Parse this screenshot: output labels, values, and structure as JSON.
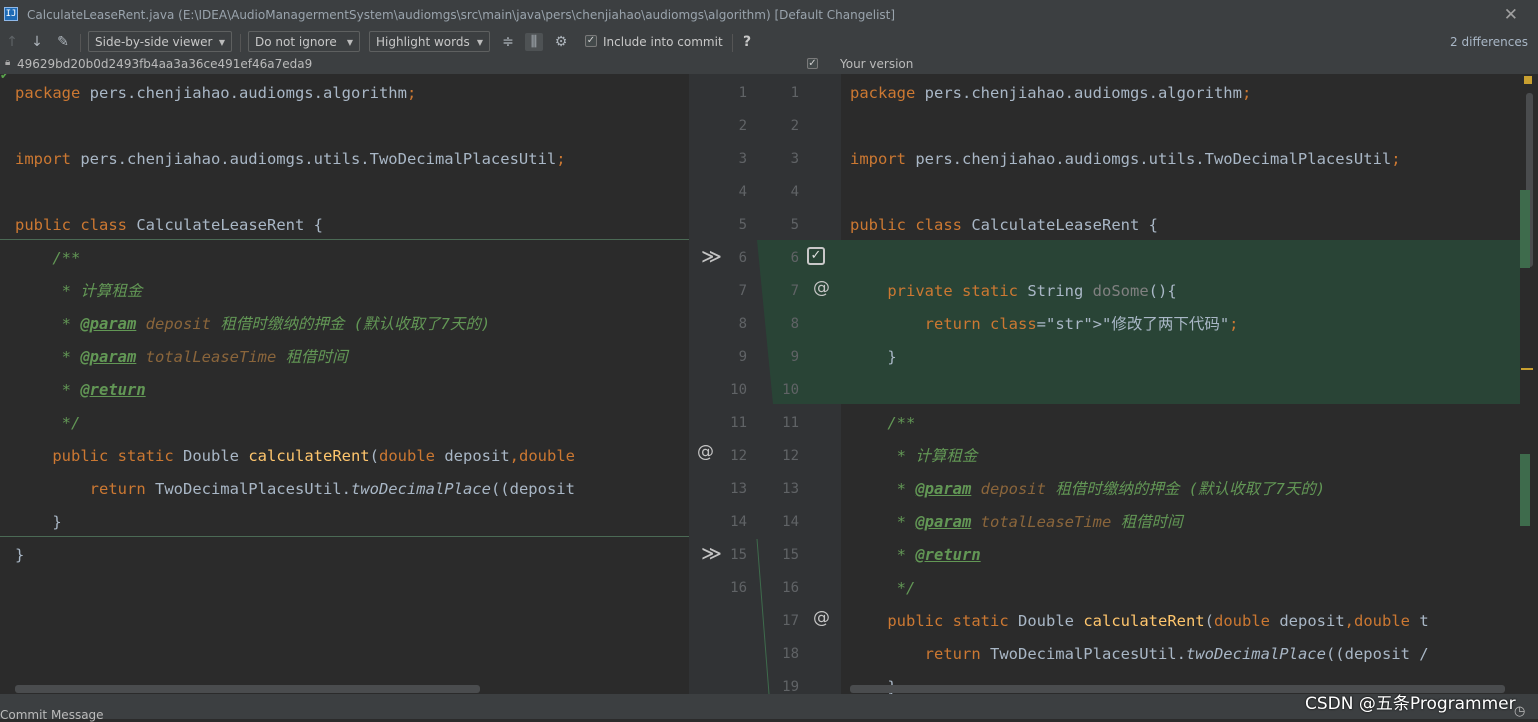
{
  "window": {
    "title": "CalculateLeaseRent.java (E:\\IDEA\\AudioManagermentSystem\\audiomgs\\src\\main\\java\\pers\\chenjiahao\\audiomgs\\algorithm) [Default Changelist]",
    "app_icon": "IJ"
  },
  "toolbar": {
    "viewer_mode": "Side-by-side viewer",
    "ignore_mode": "Do not ignore",
    "highlight_mode": "Highlight words",
    "include_commit": "Include into commit",
    "help": "?",
    "differences": "2 differences"
  },
  "headers": {
    "left_revision": "49629bd20b0d2493fb4aa3a36ce491ef46a7eda9",
    "right_title": "Your version"
  },
  "left_gutter_numbers": [
    "1",
    "2",
    "3",
    "4",
    "5",
    "6",
    "7",
    "8",
    "9",
    "10",
    "11",
    "12",
    "13",
    "14",
    "15",
    "16"
  ],
  "right_gutter_numbers": [
    "1",
    "2",
    "3",
    "4",
    "5",
    "6",
    "7",
    "8",
    "9",
    "10",
    "11",
    "12",
    "13",
    "14",
    "15",
    "16",
    "17",
    "18",
    "19"
  ],
  "left_code": [
    "package pers.chenjiahao.audiomgs.algorithm;",
    "",
    "import pers.chenjiahao.audiomgs.utils.TwoDecimalPlacesUtil;",
    "",
    "public class CalculateLeaseRent {",
    "    /**",
    "     * 计算租金",
    "     * @param deposit 租借时缴纳的押金 (默认收取了7天的)",
    "     * @param totalLeaseTime 租借时间",
    "     * @return",
    "     */",
    "    public static Double calculateRent(double deposit,double",
    "        return TwoDecimalPlacesUtil.twoDecimalPlace((deposit",
    "    }",
    "}",
    ""
  ],
  "right_code": [
    "package pers.chenjiahao.audiomgs.algorithm;",
    "",
    "import pers.chenjiahao.audiomgs.utils.TwoDecimalPlacesUtil;",
    "",
    "public class CalculateLeaseRent {",
    "",
    "    private static String doSome(){",
    "        return \"修改了两下代码\";",
    "    }",
    "",
    "    /**",
    "     * 计算租金",
    "     * @param deposit 租借时缴纳的押金 (默认收取了7天的)",
    "     * @param totalLeaseTime 租借时间",
    "     * @return",
    "     */",
    "    public static Double calculateRent(double deposit,double t",
    "        return TwoDecimalPlacesUtil.twoDecimalPlace((deposit /",
    "    }"
  ],
  "footer": {
    "commit_message": "Commit Message",
    "watermark": "CSDN @五条Programmer"
  },
  "colors": {
    "added_bg": "#294436",
    "editor_bg": "#2b2b2b",
    "gutter_bg": "#313335",
    "toolbar_bg": "#3c3f41",
    "keyword": "#cc7832",
    "function": "#ffc66d",
    "doc_comment": "#629755",
    "string": "#6a8759"
  }
}
